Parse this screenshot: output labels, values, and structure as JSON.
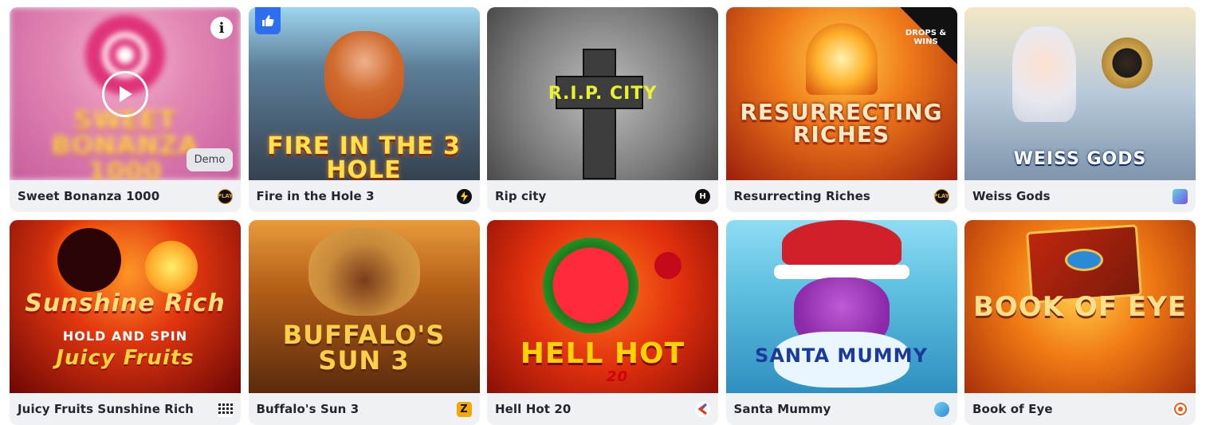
{
  "games": [
    {
      "name": "Sweet Bonanza 1000",
      "provider_icon": "play-n-go-icon",
      "provider_label": "PLAY",
      "art_title": "SWEET BONANZA 1000",
      "demo_label": "Demo",
      "bg": "#d98ab5"
    },
    {
      "name": "Fire in the Hole 3",
      "provider_icon": "lightning-icon",
      "art_title": "FIRE IN THE 3 HOLE",
      "bg": "#4a6b87"
    },
    {
      "name": "Rip city",
      "provider_icon": "hacksaw-icon",
      "provider_label": "H",
      "art_title": "R.I.P. CITY",
      "bg": "#8d8d8d"
    },
    {
      "name": "Resurrecting Riches",
      "provider_icon": "play-n-go-icon",
      "provider_label": "PLAY",
      "art_title": "RESURRECTING RICHES",
      "badge": "DROPS & WINS",
      "bg": "#c0461a"
    },
    {
      "name": "Weiss Gods",
      "provider_icon": "layers-icon",
      "art_title": "WEISS GODS",
      "bg": "#b9c6d6"
    },
    {
      "name": "Juicy Fruits Sunshine Rich",
      "provider_icon": "grid-dots-icon",
      "art_title": "Sunshine Rich",
      "art_sub": "HOLD AND SPIN",
      "art_sub2": "Juicy Fruits",
      "bg": "#b8160f"
    },
    {
      "name": "Buffalo's Sun 3",
      "provider_icon": "z-icon",
      "provider_label": "Z",
      "art_title": "BUFFALO'S SUN 3",
      "bg": "#b86a1b"
    },
    {
      "name": "Hell Hot 20",
      "provider_icon": "endorphina-icon",
      "art_title": "HELL HOT",
      "art_sub": "20",
      "bg": "#e23a12"
    },
    {
      "name": "Santa Mummy",
      "provider_icon": "leaf-icon",
      "art_title": "SANTA MUMMY",
      "bg": "#5fc0e0"
    },
    {
      "name": "Book of Eye",
      "provider_icon": "target-icon",
      "art_title": "BOOK OF EYE",
      "bg": "#e56e12"
    }
  ]
}
